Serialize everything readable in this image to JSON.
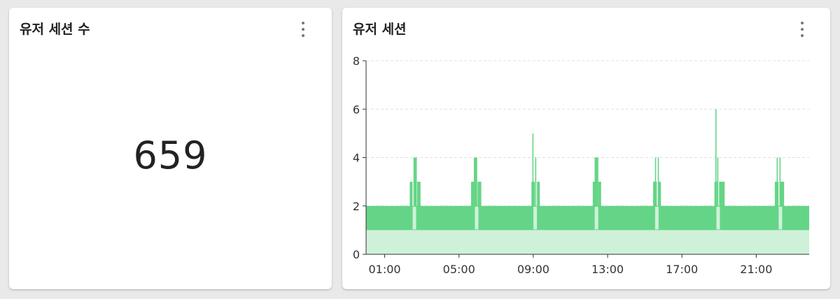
{
  "cards": {
    "count": {
      "title": "유저 세션 수",
      "value": "659"
    },
    "chart": {
      "title": "유저 세션"
    }
  },
  "colors": {
    "band": "#64d586",
    "fill": "#cff1d9",
    "spike": "#64d586",
    "grid": "#e0e0e0",
    "axis": "#333333"
  },
  "icons": {
    "menu": "more-vertical-icon"
  },
  "chart_data": {
    "type": "area",
    "title": "",
    "xlabel": "",
    "ylabel": "",
    "x_unit": "hour of day",
    "xlim": [
      0.0,
      23.85
    ],
    "ylim": [
      0,
      8
    ],
    "yticks": [
      0,
      2,
      4,
      6,
      8
    ],
    "xticks": [
      {
        "value": 1,
        "label": "01:00"
      },
      {
        "value": 5,
        "label": "05:00"
      },
      {
        "value": 9,
        "label": "09:00"
      },
      {
        "value": 13,
        "label": "13:00"
      },
      {
        "value": 17,
        "label": "17:00"
      },
      {
        "value": 21,
        "label": "21:00"
      }
    ],
    "baseline_min": 1,
    "baseline_max": 2,
    "grid": "horizontal dashed",
    "spikes": [
      {
        "x": 2.35,
        "w": 0.15,
        "y": 3
      },
      {
        "x": 2.55,
        "w": 0.18,
        "y": 4
      },
      {
        "x": 2.75,
        "w": 0.18,
        "y": 3
      },
      {
        "x": 5.65,
        "w": 0.15,
        "y": 3
      },
      {
        "x": 5.8,
        "w": 0.18,
        "y": 4
      },
      {
        "x": 6.0,
        "w": 0.2,
        "y": 3
      },
      {
        "x": 8.9,
        "w": 0.18,
        "y": 3
      },
      {
        "x": 8.95,
        "w": 0.06,
        "y": 5
      },
      {
        "x": 9.1,
        "w": 0.06,
        "y": 4
      },
      {
        "x": 9.2,
        "w": 0.15,
        "y": 3
      },
      {
        "x": 12.2,
        "w": 0.18,
        "y": 3
      },
      {
        "x": 12.3,
        "w": 0.2,
        "y": 4
      },
      {
        "x": 12.5,
        "w": 0.15,
        "y": 3
      },
      {
        "x": 15.45,
        "w": 0.2,
        "y": 3
      },
      {
        "x": 15.55,
        "w": 0.06,
        "y": 4
      },
      {
        "x": 15.7,
        "w": 0.06,
        "y": 4
      },
      {
        "x": 15.75,
        "w": 0.12,
        "y": 3
      },
      {
        "x": 18.75,
        "w": 0.15,
        "y": 3
      },
      {
        "x": 18.8,
        "w": 0.06,
        "y": 6
      },
      {
        "x": 18.9,
        "w": 0.06,
        "y": 4
      },
      {
        "x": 19.0,
        "w": 0.3,
        "y": 3
      },
      {
        "x": 22.0,
        "w": 0.2,
        "y": 3
      },
      {
        "x": 22.1,
        "w": 0.06,
        "y": 4
      },
      {
        "x": 22.25,
        "w": 0.06,
        "y": 4
      },
      {
        "x": 22.3,
        "w": 0.2,
        "y": 3
      }
    ],
    "dips": [
      2.6,
      5.95,
      9.1,
      12.4,
      15.65,
      18.95,
      22.3
    ]
  }
}
